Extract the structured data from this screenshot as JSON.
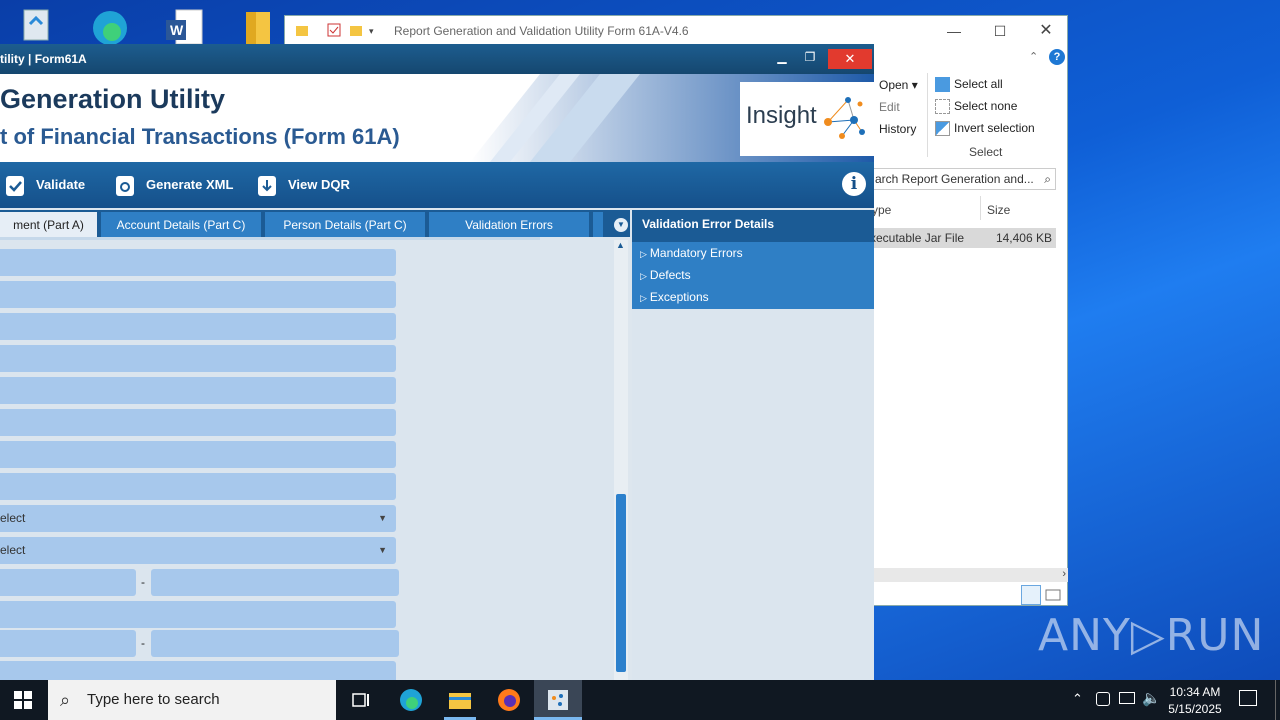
{
  "explorer": {
    "title": "Report Generation and Validation Utility Form 61A-V4.6",
    "ribbon": {
      "open": "Open ▾",
      "edit": "Edit",
      "history": "History",
      "select_all": "Select all",
      "select_none": "Select none",
      "invert_selection": "Invert selection",
      "group_label": "Select"
    },
    "search_placeholder": "arch Report Generation and...",
    "columns": {
      "type": "ype",
      "size": "Size"
    },
    "file": {
      "type": "xecutable Jar File",
      "size": "14,406 KB"
    }
  },
  "app": {
    "title": "tility | Form61A",
    "banner_title": "Generation Utility",
    "banner_subtitle": "t of Financial Transactions (Form 61A)",
    "brand": "Insight",
    "toolbar": {
      "validate": "Validate",
      "generate_xml": "Generate XML",
      "view_dqr": "View DQR"
    },
    "tabs": [
      "ment (Part A)",
      "Account Details (Part C)",
      "Person Details (Part C)",
      "Validation Errors"
    ],
    "select_placeholder": "elect",
    "dash": "-",
    "error_panel": {
      "title": "Validation Error Details",
      "items": [
        "Mandatory Errors",
        "Defects",
        "Exceptions"
      ]
    }
  },
  "taskbar": {
    "search_placeholder": "Type here to search",
    "time": "10:34 AM",
    "date": "5/15/2025"
  },
  "watermark": "ANY▷RUN"
}
